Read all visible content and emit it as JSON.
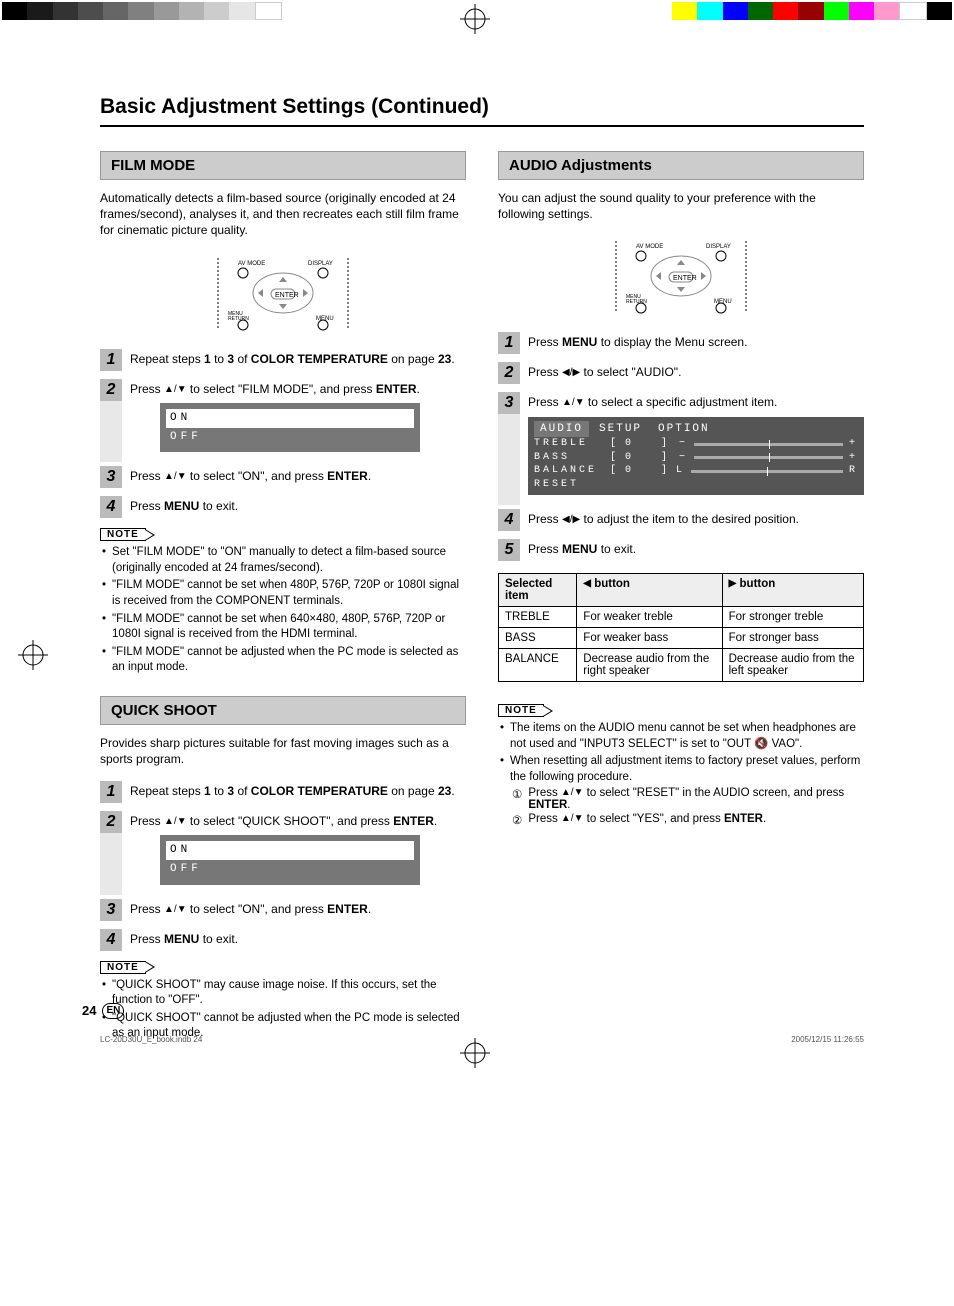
{
  "page_title": "Basic Adjustment Settings (Continued)",
  "page_number": "24",
  "lang_badge": "EN",
  "footer_left": "LC-20D30U_E_book.indb   24",
  "footer_right": "2005/12/15   11:26:55",
  "film": {
    "heading": "FILM MODE",
    "intro": "Automatically detects a film-based source (originally encoded at 24 frames/second), analyses it, and then recreates each still film frame for cinematic picture quality.",
    "step1_a": "Repeat steps ",
    "step1_b": "1",
    "step1_c": " to ",
    "step1_d": "3",
    "step1_e": " of ",
    "step1_f": "COLOR TEMPERATURE",
    "step1_g": " on page ",
    "step1_h": "23",
    "step1_i": ".",
    "step2_a": "Press ",
    "step2_b": " to select \"FILM MODE\", and press ",
    "step2_c": "ENTER",
    "step2_d": ".",
    "menu_on": "ON",
    "menu_off": "OFF",
    "step3_a": "Press ",
    "step3_b": " to select \"ON\", and press ",
    "step3_c": "ENTER",
    "step3_d": ".",
    "step4_a": "Press ",
    "step4_b": "MENU",
    "step4_c": " to exit.",
    "note_label": "NOTE",
    "notes": [
      "Set \"FILM MODE\" to \"ON\" manually to detect a film-based source (originally encoded at 24 frames/second).",
      "\"FILM MODE\" cannot be set when 480P, 576P, 720P or 1080I signal is received from the COMPONENT terminals.",
      "\"FILM MODE\" cannot be set when 640×480, 480P, 576P, 720P or 1080I signal is received from the HDMI terminal.",
      "\"FILM MODE\" cannot be adjusted when the PC mode is selected as an input mode."
    ]
  },
  "quick": {
    "heading": "QUICK SHOOT",
    "intro": "Provides sharp pictures suitable for fast moving images such as a sports program.",
    "step1_a": "Repeat steps ",
    "step1_b": "1",
    "step1_c": " to ",
    "step1_d": "3",
    "step1_e": " of ",
    "step1_f": "COLOR TEMPERATURE",
    "step1_g": " on page ",
    "step1_h": "23",
    "step1_i": ".",
    "step2_a": "Press ",
    "step2_b": " to select \"QUICK SHOOT\", and press ",
    "step2_c": "ENTER",
    "step2_d": ".",
    "menu_on": "ON",
    "menu_off": "OFF",
    "step3_a": "Press ",
    "step3_b": " to select \"ON\", and press ",
    "step3_c": "ENTER",
    "step3_d": ".",
    "step4_a": "Press ",
    "step4_b": "MENU",
    "step4_c": " to exit.",
    "note_label": "NOTE",
    "notes": [
      "\"QUICK SHOOT\" may cause image noise. If this occurs, set the function to \"OFF\".",
      "\"QUICK SHOOT\" cannot be adjusted when the PC mode is selected as an input mode."
    ]
  },
  "audio": {
    "heading": "AUDIO Adjustments",
    "intro": "You can adjust the sound quality to your preference with the following settings.",
    "step1_a": "Press ",
    "step1_b": "MENU",
    "step1_c": " to display the Menu screen.",
    "step2_a": "Press ",
    "step2_b": " to select \"AUDIO\".",
    "step3_a": "Press ",
    "step3_b": " to select a specific adjustment item.",
    "osd_tab1": "AUDIO",
    "osd_tab2": "SETUP",
    "osd_tab3": "OPTION",
    "osd_treble": "TREBLE",
    "osd_bass": "BASS",
    "osd_balance": "BALANCE",
    "osd_reset": "RESET",
    "osd_val": "0",
    "osd_L": "L",
    "osd_R": "R",
    "step4_a": "Press ",
    "step4_b": " to adjust the item to the desired position.",
    "step5_a": "Press ",
    "step5_b": "MENU",
    "step5_c": " to exit.",
    "table": {
      "h1": "Selected item",
      "h2_left": " button",
      "h2_right": " button",
      "rows": [
        {
          "item": "TREBLE",
          "left": "For weaker treble",
          "right": "For stronger treble"
        },
        {
          "item": "BASS",
          "left": "For weaker bass",
          "right": "For stronger bass"
        },
        {
          "item": "BALANCE",
          "left": "Decrease audio from the right speaker",
          "right": "Decrease audio from the left speaker"
        }
      ]
    },
    "note_label": "NOTE",
    "note1": "The items on the AUDIO menu cannot be set when headphones are not used and \"INPUT3 SELECT\" is set to \"OUT 🔇 VAO\".",
    "note2": "When resetting all adjustment items to factory preset values, perform the following procedure.",
    "sub1_a": "Press ",
    "sub1_b": " to select \"RESET\" in the AUDIO screen, and press ",
    "sub1_c": "ENTER",
    "sub1_d": ".",
    "sub2_a": "Press ",
    "sub2_b": " to select \"YES\", and press ",
    "sub2_c": "ENTER",
    "sub2_d": "."
  }
}
